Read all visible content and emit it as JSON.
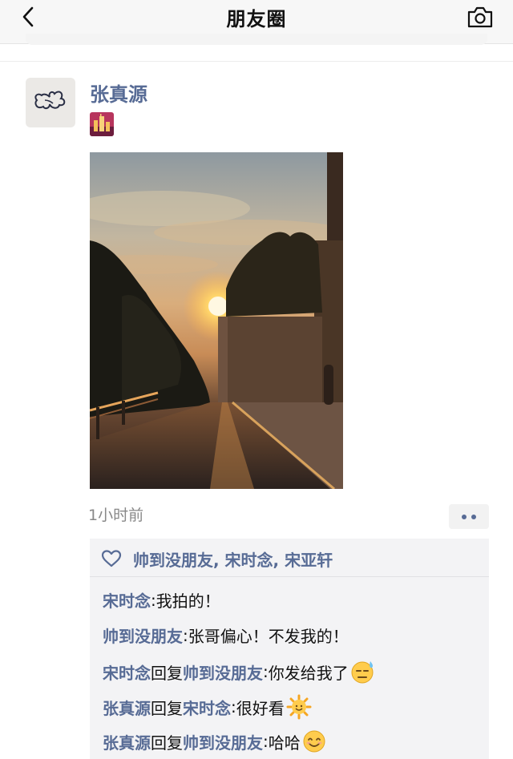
{
  "nav": {
    "title": "朋友圈",
    "back_icon": "chevron-left-icon",
    "camera_icon": "camera-icon"
  },
  "post": {
    "author": "张真源",
    "time": "1小时前",
    "more_icon": "more-dots-icon",
    "photo_description_icon": "sunset-street-photo",
    "likes": {
      "icon": "heart-outline-icon",
      "names": "帅到没朋友, 宋时念, 宋亚轩"
    },
    "comments": [
      {
        "name": "宋时念",
        "sep": ": ",
        "text": "我拍的！"
      },
      {
        "name": "帅到没朋友",
        "sep": ": ",
        "text": "张哥偏心！不发我的！"
      },
      {
        "name": "宋时念",
        "reply": "回复",
        "to": "帅到没朋友",
        "sep": ": ",
        "text": "你发给我了",
        "emoji": "sweat-emoji"
      },
      {
        "name": "张真源",
        "reply": "回复",
        "to": "宋时念",
        "sep": ": ",
        "text": "很好看",
        "emoji": "sun-emoji"
      },
      {
        "name": "张真源",
        "reply": "回复",
        "to": "帅到没朋友",
        "sep": ": ",
        "text": "哈哈",
        "emoji": "smile-emoji"
      }
    ]
  },
  "colors": {
    "link": "#576b95",
    "nav_bg": "#f7f7f7",
    "comment_bg": "#f3f3f5"
  }
}
